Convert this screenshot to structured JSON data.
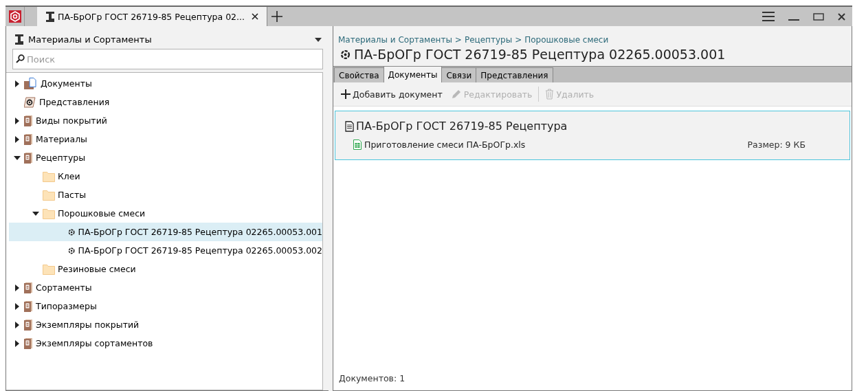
{
  "window_tabs": [
    {
      "label": "ПА-БрОГр ГОСТ 26719-85 Рецептура 02...",
      "selected": true
    }
  ],
  "left_panel": {
    "title": "Материалы и Сортаменты",
    "search": {
      "placeholder": "Поиск"
    },
    "tree": [
      {
        "kind": "documents",
        "label": "Документы",
        "expanded": false,
        "selected": false
      },
      {
        "kind": "views",
        "label": "Представления",
        "selected": false
      },
      {
        "kind": "library",
        "label": "Виды покрытий",
        "expanded": false,
        "selected": false
      },
      {
        "kind": "library",
        "label": "Материалы",
        "expanded": false,
        "selected": false
      },
      {
        "kind": "library",
        "label": "Рецептуры",
        "expanded": true,
        "selected": false,
        "children": [
          {
            "kind": "folder",
            "label": "Клеи",
            "selected": false
          },
          {
            "kind": "folder",
            "label": "Пасты",
            "selected": false
          },
          {
            "kind": "folder",
            "label": "Порошковые смеси",
            "expanded": true,
            "selected": false,
            "children": [
              {
                "kind": "recipe",
                "label": "ПА-БрОГр ГОСТ 26719-85 Рецептура 02265.00053.001",
                "selected": true
              },
              {
                "kind": "recipe",
                "label": "ПА-БрОГр ГОСТ 26719-85 Рецептура 02265.00053.002",
                "selected": false
              }
            ]
          },
          {
            "kind": "folder",
            "label": "Резиновые смеси",
            "selected": false
          }
        ]
      },
      {
        "kind": "library",
        "label": "Сортаменты",
        "expanded": false,
        "selected": false
      },
      {
        "kind": "library",
        "label": "Типоразмеры",
        "expanded": false,
        "selected": false
      },
      {
        "kind": "library",
        "label": "Экземпляры покрытий",
        "expanded": false,
        "selected": false
      },
      {
        "kind": "library",
        "label": "Экземпляры сортаментов",
        "expanded": false,
        "selected": false
      }
    ]
  },
  "right_panel": {
    "breadcrumb": [
      "Материалы и Сортаменты",
      "Рецептуры",
      "Порошковые смеси"
    ],
    "breadcrumb_separator": ">",
    "title": "ПА-БрОГр ГОСТ 26719-85 Рецептура 02265.00053.001",
    "tabs": [
      {
        "label": "Свойства",
        "selected": false
      },
      {
        "label": "Документы",
        "selected": true
      },
      {
        "label": "Связи",
        "selected": false
      },
      {
        "label": "Представления",
        "selected": false
      }
    ],
    "toolbar": [
      {
        "kind": "add",
        "label": "Добавить документ",
        "disabled": false
      },
      {
        "kind": "edit",
        "label": "Редактировать",
        "disabled": true
      },
      {
        "kind": "delete",
        "label": "Удалить",
        "disabled": true
      }
    ],
    "documents": [
      {
        "title": "ПА-БрОГр ГОСТ 26719-85 Рецептура",
        "files": [
          {
            "name": "Приготовление смеси ПА-БрОГр.xls",
            "size": "Размер: 9 КБ"
          }
        ]
      }
    ],
    "status": "Документов: 1"
  }
}
